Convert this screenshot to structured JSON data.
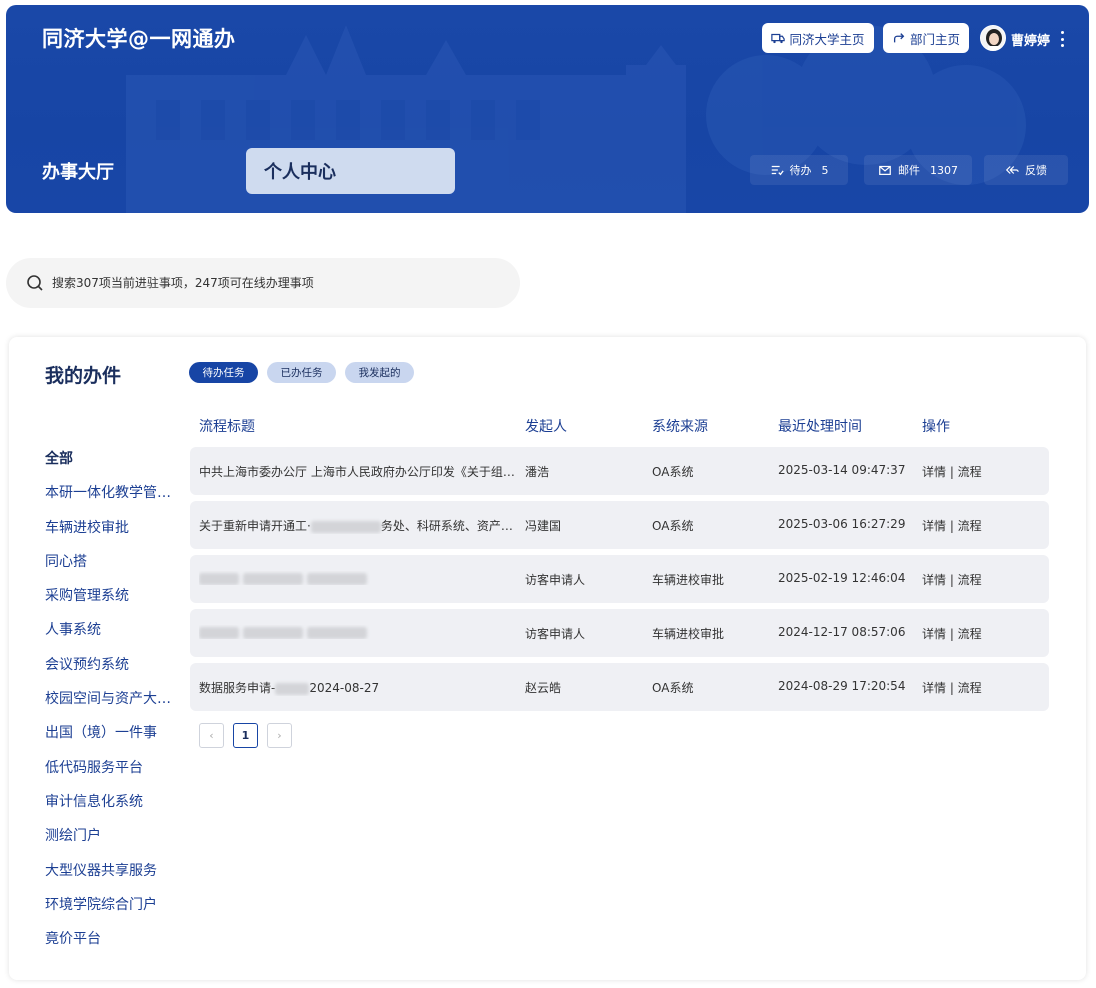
{
  "header": {
    "app_title": "同济大学@一网通办",
    "btn_university_home": "同济大学主页",
    "btn_dept_home": "部门主页",
    "username": "曹婷婷",
    "hall": "办事大厅",
    "personal_center": "个人中心",
    "todo_label": "待办",
    "todo_count": "5",
    "mail_label": "邮件",
    "mail_count": "1307",
    "feedback_label": "反馈"
  },
  "search": {
    "placeholder": "搜索307项当前进驻事项，247项可在线办理事项"
  },
  "card": {
    "title": "我的办件",
    "tabs": [
      {
        "label": "待办任务",
        "active": true
      },
      {
        "label": "已办任务",
        "active": false
      },
      {
        "label": "我发起的",
        "active": false
      }
    ]
  },
  "sidebar": {
    "items": [
      "全部",
      "本研一体化教学管理系统",
      "车辆进校审批",
      "同心搭",
      "采购管理系统",
      "人事系统",
      "会议预约系统",
      "校园空间与资产大数据平台",
      "出国（境）一件事",
      "低代码服务平台",
      "审计信息化系统",
      "测绘门户",
      "大型仪器共享服务",
      "环境学院综合门户",
      "竟价平台"
    ]
  },
  "table": {
    "headers": [
      "流程标题",
      "发起人",
      "系统来源",
      "最近处理时间",
      "操作"
    ],
    "rows": [
      {
        "title": "中共上海市委办公厅 上海市人民政府办公厅印发《关于组织…",
        "initiator": "潘浩",
        "source": "OA系统",
        "time": "2025-03-14 09:47:37",
        "action": "详情 | 流程"
      },
      {
        "title_pre": "关于重新申请开通工·",
        "title_post": "务处、科研系统、资产处…",
        "initiator": "冯建国",
        "source": "OA系统",
        "time": "2025-03-06 16:27:29",
        "action": "详情 | 流程"
      },
      {
        "initiator": "访客申请人",
        "source": "车辆进校审批",
        "time": "2025-02-19 12:46:04",
        "action": "详情 | 流程"
      },
      {
        "initiator": "访客申请人",
        "source": "车辆进校审批",
        "time": "2024-12-17 08:57:06",
        "action": "详情 | 流程"
      },
      {
        "title_pre": "数据服务申请-",
        "title_post": "2024-08-27",
        "initiator": "赵云皓",
        "source": "OA系统",
        "time": "2024-08-29 17:20:54",
        "action": "详情 | 流程"
      }
    ]
  },
  "pagination": {
    "prev": "‹",
    "current": "1",
    "next": "›"
  }
}
